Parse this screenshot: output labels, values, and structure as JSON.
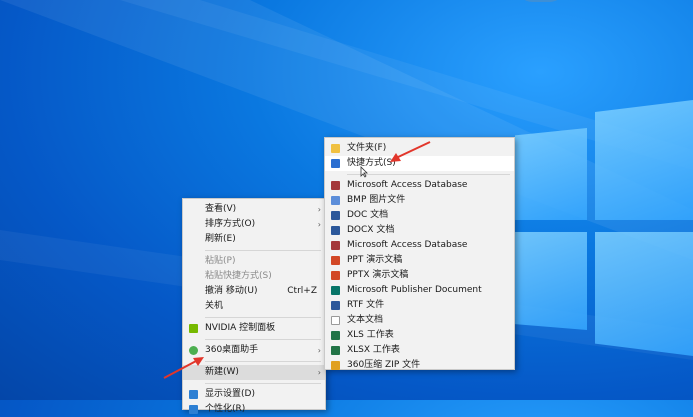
{
  "desktop_menu": {
    "items": [
      {
        "label": "查看(V)",
        "arrow": "›"
      },
      {
        "label": "排序方式(O)",
        "arrow": "›"
      },
      {
        "label": "刷新(E)"
      },
      {
        "label": "粘贴(P)",
        "disabled": true
      },
      {
        "label": "粘贴快捷方式(S)",
        "disabled": true
      },
      {
        "label": "撤消 移动(U)",
        "shortcut": "Ctrl+Z"
      },
      {
        "label": "关机"
      },
      {
        "label": "NVIDIA 控制面板",
        "icon": "nvidia-icon",
        "color": "#76b900"
      },
      {
        "label": "360桌面助手",
        "icon": "360-assistant-icon",
        "color": "#4caf50",
        "arrow": "›"
      },
      {
        "label": "新建(W)",
        "arrow": "›"
      },
      {
        "label": "显示设置(D)",
        "icon": "display-settings-icon",
        "color": "#2d7fd3"
      },
      {
        "label": "个性化(R)",
        "icon": "personalize-icon",
        "color": "#2d7fd3"
      }
    ]
  },
  "new_submenu": {
    "items": [
      {
        "label": "文件夹(F)",
        "icon": "folder-icon",
        "color": "#f0c040"
      },
      {
        "label": "快捷方式(S)",
        "icon": "shortcut-icon",
        "color": "#2b6fd1"
      },
      {
        "label": "Microsoft Access Database",
        "icon": "access-icon",
        "color": "#a4373a"
      },
      {
        "label": "BMP 图片文件",
        "icon": "bmp-icon",
        "color": "#5b8dd9"
      },
      {
        "label": "DOC 文档",
        "icon": "doc-icon",
        "color": "#2b579a"
      },
      {
        "label": "DOCX 文档",
        "icon": "docx-icon",
        "color": "#2b579a"
      },
      {
        "label": "Microsoft Access Database",
        "icon": "access-icon",
        "color": "#a4373a"
      },
      {
        "label": "PPT 演示文稿",
        "icon": "ppt-icon",
        "color": "#d24726"
      },
      {
        "label": "PPTX 演示文稿",
        "icon": "pptx-icon",
        "color": "#d24726"
      },
      {
        "label": "Microsoft Publisher Document",
        "icon": "publisher-icon",
        "color": "#077568"
      },
      {
        "label": "RTF 文件",
        "icon": "rtf-icon",
        "color": "#2b579a"
      },
      {
        "label": "文本文档",
        "icon": "text-document-icon",
        "color": "#9a9a9a"
      },
      {
        "label": "XLS 工作表",
        "icon": "xls-icon",
        "color": "#217346"
      },
      {
        "label": "XLSX 工作表",
        "icon": "xlsx-icon",
        "color": "#217346"
      },
      {
        "label": "360压缩 ZIP 文件",
        "icon": "zip-icon",
        "color": "#e0a020"
      }
    ]
  },
  "annotation_color": "#e2362b"
}
